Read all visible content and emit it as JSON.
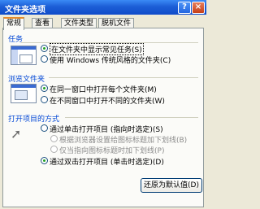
{
  "window": {
    "title": "文件夹选项",
    "help_label": "?",
    "close_label": "×"
  },
  "tabs": [
    {
      "label": "常规"
    },
    {
      "label": "查看"
    },
    {
      "label": "文件类型"
    },
    {
      "label": "脱机文件"
    }
  ],
  "tasks": {
    "title": "任务",
    "options": [
      {
        "label": "在文件夹中显示常见任务(S)"
      },
      {
        "label": "使用 Windows 传统风格的文件夹(C)"
      }
    ]
  },
  "browse": {
    "title": "浏览文件夹",
    "options": [
      {
        "label": "在同一窗口中打开每个文件夹(M)"
      },
      {
        "label": "在不同窗口中打开不同的文件夹(W)"
      }
    ]
  },
  "open_items": {
    "title": "打开项目的方式",
    "options": [
      {
        "label": "通过单击打开项目 (指向时选定)(S)"
      },
      {
        "label": "根据浏览器设置给图标标题加下划线(B)"
      },
      {
        "label": "仅当指向图标标题时加下划线(P)"
      },
      {
        "label": "通过双击打开项目 (单击时选定)(D)"
      }
    ]
  },
  "restore_button": {
    "label": "还原为默认值(D)"
  }
}
